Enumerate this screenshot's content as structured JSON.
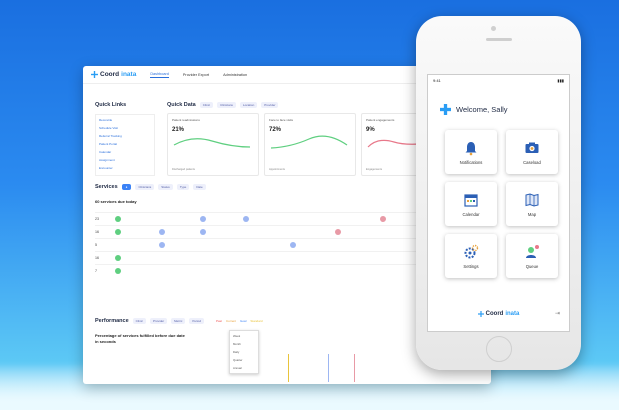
{
  "desktop": {
    "brand": {
      "part1": "Coord",
      "part2": "inata"
    },
    "nav": [
      "Dashboard",
      "Provider Export",
      "Administration"
    ],
    "quick_links": {
      "title": "Quick Links",
      "items": [
        "Reconcile",
        "Schedule Visit",
        "Referral Tracking",
        "Patient Portal",
        "Calendar",
        "Assignment",
        "Encounter"
      ]
    },
    "quick_data": {
      "title": "Quick Data",
      "chips": [
        "Clinic",
        "Clinicians",
        "Location",
        "Provider"
      ],
      "cards": [
        {
          "label": "Patient readmissions",
          "value": "21%",
          "foot": "Discharged patients"
        },
        {
          "label": "Face to face visits",
          "value": "72%",
          "foot": "Appointments"
        },
        {
          "label": "Patient engagements",
          "value": "9%",
          "foot": "Engagements"
        }
      ]
    },
    "services": {
      "title": "Services",
      "chips": [
        "Clinicians",
        "Status",
        "Type",
        "Date"
      ],
      "subtitle": "60 services due today",
      "days": [
        "23",
        "16",
        "5",
        "16",
        "7"
      ]
    },
    "performance": {
      "title": "Performance",
      "chips": [
        "Clinic",
        "Provider",
        "Metric",
        "Period"
      ],
      "subtitle": "Percentage of services fulfilled before due date in seconds",
      "legend": [
        "Past",
        "Current",
        "Goal",
        "Standard"
      ],
      "menu": [
        "Week",
        "Month",
        "Daily",
        "Quarter",
        "Annual"
      ]
    }
  },
  "phone": {
    "status_time": "9:41",
    "welcome": "Welcome, Sally",
    "tiles": [
      {
        "label": "Notifications",
        "icon": "bell-icon"
      },
      {
        "label": "Caseload",
        "icon": "camera-icon"
      },
      {
        "label": "Calendar",
        "icon": "calendar-icon"
      },
      {
        "label": "Map",
        "icon": "map-icon"
      },
      {
        "label": "Settings",
        "icon": "gear-icon"
      },
      {
        "label": "Queue",
        "icon": "user-queue-icon"
      }
    ],
    "brand": {
      "part1": "Coord",
      "part2": "inata"
    }
  },
  "colors": {
    "accent": "#2a6fdb",
    "brand_blue": "#2a9df4",
    "green": "#5fcf80",
    "bg_top": "#1a6fe0"
  }
}
